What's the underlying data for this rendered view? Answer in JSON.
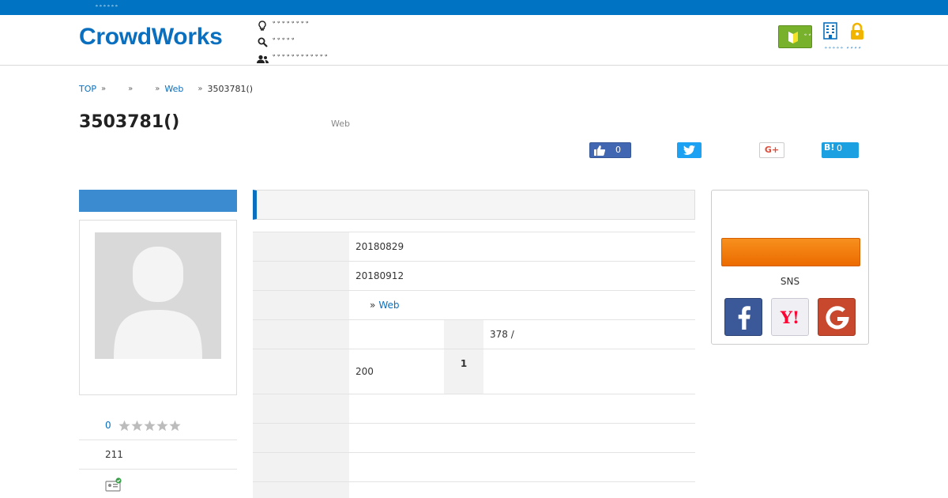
{
  "topbar": {
    "tag": "ﾞﾞﾞﾞﾞﾞ"
  },
  "header": {
    "logo": "CrowdWorks",
    "nav": [
      {
        "label": "ﾞﾞﾞﾞﾞﾞﾞﾞ",
        "icon": "lightbulb-icon"
      },
      {
        "label": "ﾞﾞﾞﾞﾞ",
        "icon": "search-icon"
      },
      {
        "label": "ﾞﾞﾞﾞﾞﾞﾞﾞﾞﾞﾞﾞ",
        "icon": "users-icon"
      }
    ],
    "beginner_label": "ﾞﾞﾞﾞﾞ",
    "account_links": "ﾞﾞﾞﾞﾞ ﾞﾞﾞﾞ"
  },
  "breadcrumb": {
    "items": [
      "TOP",
      "",
      "",
      "Web",
      "3503781()"
    ]
  },
  "job": {
    "title": "3503781()",
    "category": "Web"
  },
  "share": {
    "facebook_count": "0",
    "google_label": "G+",
    "hatena_label": "B!",
    "hatena_count": "0"
  },
  "client": {
    "rating_count": "0",
    "rating_stars": 0,
    "rating_max": 5,
    "projects_count": "211"
  },
  "details": {
    "rows": [
      {
        "value": "20180829"
      },
      {
        "value": "20180912"
      },
      {
        "value": "Web",
        "arrow": "»"
      },
      {
        "sub_value": "378 /"
      },
      {
        "value": "200",
        "sub_label": "1"
      },
      {
        "value": ""
      },
      {
        "value": ""
      },
      {
        "value": ""
      },
      {
        "value": ""
      }
    ]
  },
  "sidebar": {
    "sns_label": "SNS"
  },
  "colors": {
    "brand_blue": "#0074c2",
    "apply_orange": "#f08300",
    "beginner_green": "#78b22c"
  }
}
